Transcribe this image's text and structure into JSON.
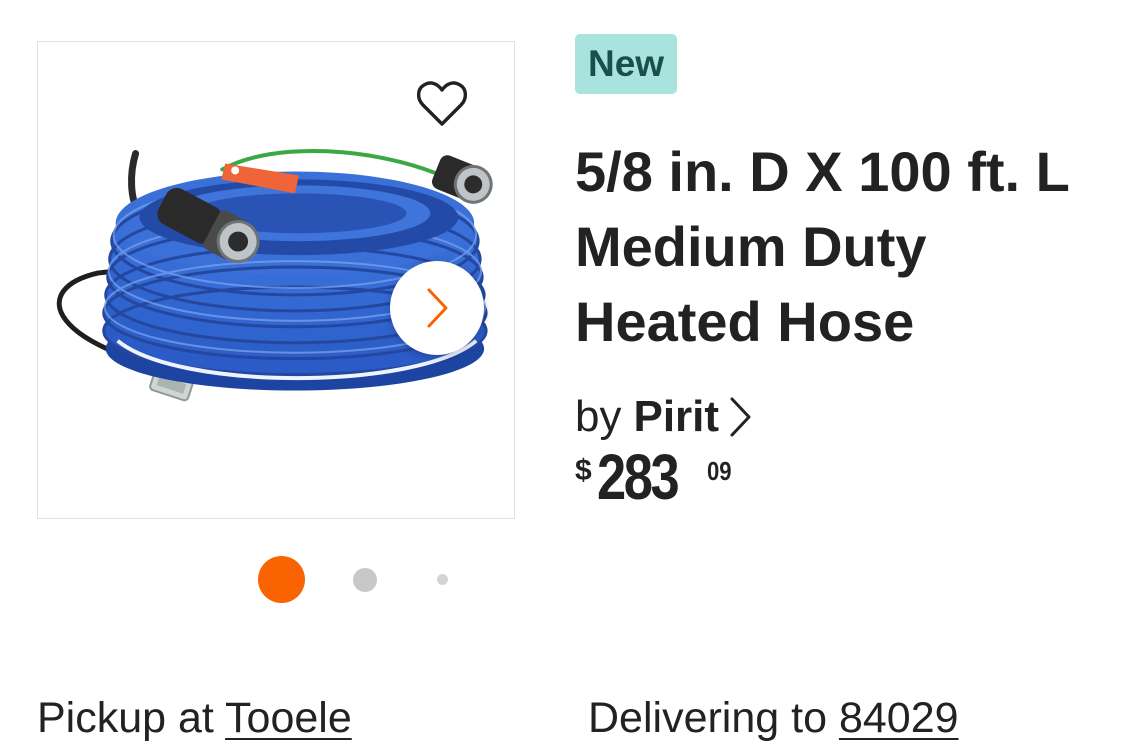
{
  "product": {
    "badge": "New",
    "title": "5/8 in. D X 100 ft. L Medium Duty Heated Hose",
    "brand_prefix": "by",
    "brand": "Pirit",
    "price": {
      "currency": "$",
      "dollars": "283",
      "cents": "09"
    },
    "image": {
      "alt": "Blue heated garden hose coil with orange tag and black power cord"
    }
  },
  "gallery": {
    "image_count": 3,
    "active_index": 0
  },
  "icons": {
    "favorite": "heart-outline-icon",
    "next": "chevron-right-icon",
    "brand_link": "chevron-right-icon"
  },
  "fulfillment": {
    "pickup_label": "Pickup at",
    "pickup_store": "Tooele",
    "delivery_label": "Delivering to",
    "delivery_zip": "84029"
  },
  "colors": {
    "badge_bg": "#a8e3de",
    "badge_text": "#1b4f4d",
    "accent": "#f96302",
    "dot_inactive": "#c8c8c8",
    "dot_inactive_small": "#d4d4d4",
    "hose_blue": "#2d5fc9"
  }
}
